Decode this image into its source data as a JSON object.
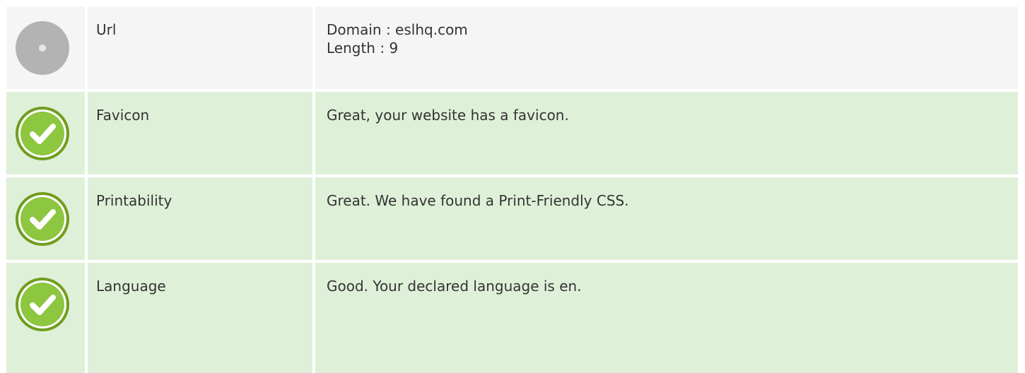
{
  "rows": [
    {
      "status": "neutral",
      "icon": "neutral-dot-icon",
      "label": "Url",
      "lines": [
        "Domain : eslhq.com",
        "Length : 9"
      ]
    },
    {
      "status": "pass",
      "icon": "check-icon",
      "label": "Favicon",
      "lines": [
        "Great, your website has a favicon."
      ]
    },
    {
      "status": "pass",
      "icon": "check-icon",
      "label": "Printability",
      "lines": [
        "Great. We have found a Print-Friendly CSS."
      ]
    },
    {
      "status": "pass",
      "icon": "check-icon",
      "label": "Language",
      "lines": [
        "Good. Your declared language is en."
      ]
    }
  ],
  "colors": {
    "neutral_bg": "#f5f5f5",
    "pass_bg": "#dff0d8",
    "check_green": "#8dc63f",
    "neutral_gray": "#b3b3b3"
  }
}
